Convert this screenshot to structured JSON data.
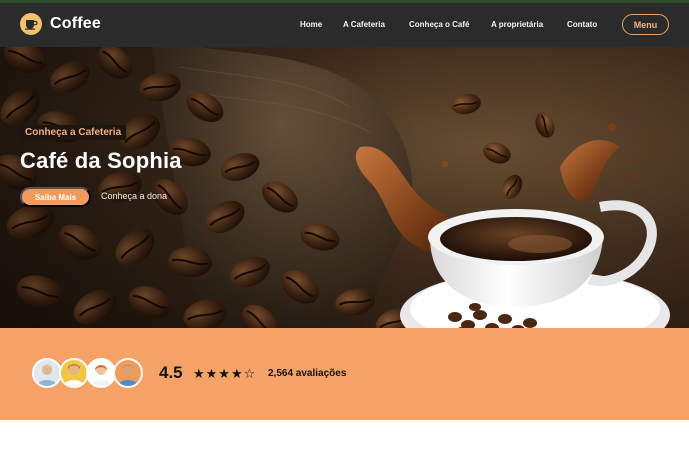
{
  "brand": {
    "name": "Coffee",
    "logo_icon": "coffee-cup-icon"
  },
  "nav": {
    "items": [
      {
        "label": "Home"
      },
      {
        "label": "A Cafeteria"
      },
      {
        "label": "Conheça o Café"
      },
      {
        "label": "A proprietária"
      },
      {
        "label": "Contato"
      }
    ],
    "menu_label": "Menu"
  },
  "hero": {
    "eyebrow": "Conheça a Cafeteria",
    "title": "Café da Sophia",
    "primary_button": "Saiba Mais",
    "secondary_link": "Conheça a dona"
  },
  "reviews": {
    "rating": "4.5",
    "stars_display": "★★★★☆",
    "stars_value": 4.5,
    "count_text": "2,564 avaliações",
    "avatar_count": 4
  },
  "colors": {
    "nav_bg": "#2b2b2b",
    "accent_orange": "#f4a266",
    "button_orange": "#f09a5c",
    "logo_yellow": "#f2c168"
  }
}
